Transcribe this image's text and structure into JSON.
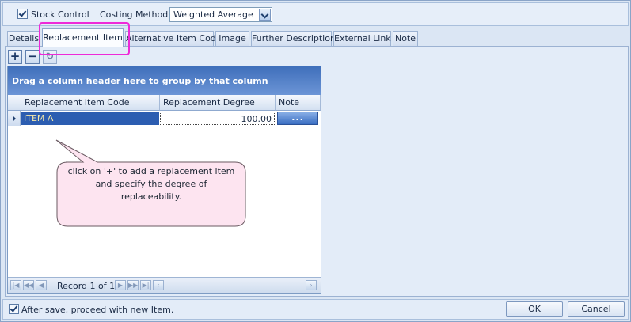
{
  "topbar": {
    "stock_control": {
      "label": "Stock Control",
      "checked": true
    },
    "costing_method": {
      "label": "Costing Method:",
      "value": "Weighted Average"
    }
  },
  "tabs": [
    {
      "label": "Details"
    },
    {
      "label": "Replacement Item",
      "active": true
    },
    {
      "label": "Alternative Item Code"
    },
    {
      "label": "Image"
    },
    {
      "label": "Further Description"
    },
    {
      "label": "External Link"
    },
    {
      "label": "Note"
    }
  ],
  "toolbar": {
    "add": "+",
    "remove": "−",
    "refresh": "↻"
  },
  "grid": {
    "group_panel": "Drag a column header here to group by that column",
    "columns": [
      "Replacement Item Code",
      "Replacement Degree",
      "Note"
    ],
    "rows": [
      {
        "code": "ITEM A",
        "degree": "100.00",
        "note": "..."
      }
    ],
    "navigator": {
      "record_text": "Record 1 of 1"
    }
  },
  "callout": {
    "lines": [
      "click on '+' to add a replacement item",
      "and specify the degree of",
      "replaceability."
    ]
  },
  "footer": {
    "proceed": {
      "label": "After save, proceed with new Item.",
      "checked": true
    },
    "ok": "OK",
    "cancel": "Cancel"
  },
  "colors": {
    "highlight": "#ee2ad8",
    "callout_fill": "#fde4f0",
    "grid_header": "#3f6fbb"
  }
}
